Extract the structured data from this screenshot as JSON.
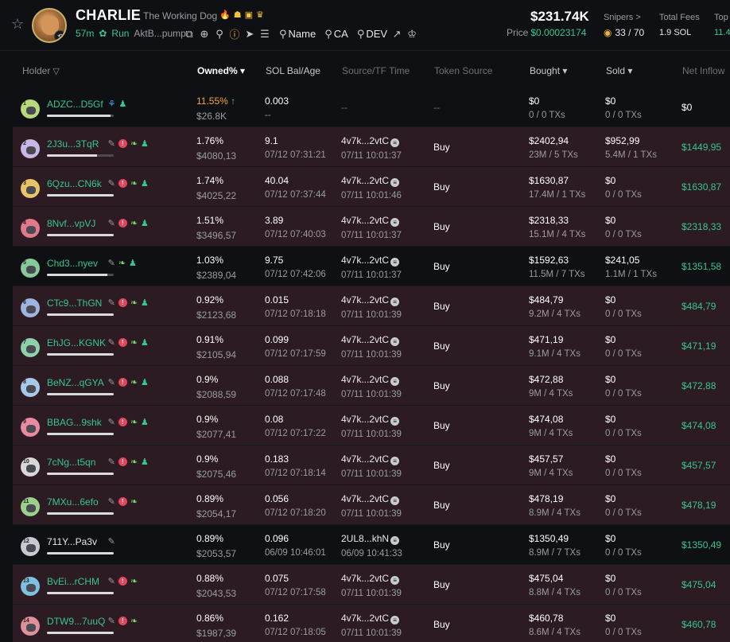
{
  "token": {
    "name": "CHARLIE",
    "subtitle": "The Working Dog",
    "age": "57m",
    "run_label": "Run",
    "address": "AktB...pump",
    "price_big": "$231.74K",
    "price_label": "Price",
    "price_value": "$0.00023174",
    "snipers_label": "Snipers >",
    "snipers_value": "33 / 70",
    "fees_label": "Total Fees",
    "fees_value": "1.9 SOL",
    "top10_label": "Top",
    "top10_value": "11.4",
    "search_name": "Name",
    "search_ca": "CA",
    "search_dev": "DEV"
  },
  "columns": {
    "holder": "Holder",
    "owned": "Owned%",
    "sol": "SOL Bal/Age",
    "source": "Source/TF Time",
    "token_source": "Token Source",
    "bought": "Bought",
    "sold": "Sold",
    "net": "Net Inflow"
  },
  "colors": {
    "accent_green": "#36c68f",
    "row_red": "#2c1b22",
    "warning_orange": "#f3a53c"
  },
  "rows": [
    {
      "rank": "1",
      "addr": "ADZC...D5Gf",
      "owned": "11.55%",
      "owned_usd": "$26.8K",
      "sol": "0.003",
      "age": "--",
      "src": "--",
      "src_time": "",
      "tsrc": "--",
      "bought": "$0",
      "bought_tx": "0 / 0 TXs",
      "sold": "$0",
      "sold_tx": "0 / 0 TXs",
      "net": "$0",
      "style": "top",
      "bar": 0.95,
      "badges": [
        "fish",
        "person"
      ]
    },
    {
      "rank": "2",
      "addr": "2J3u...3TqR",
      "owned": "1.76%",
      "owned_usd": "$4080,13",
      "sol": "9.1",
      "age": "07/12 07:31:21",
      "src": "4v7k...2vtC",
      "src_time": "07/11 10:01:37",
      "tsrc": "Buy",
      "bought": "$2402,94",
      "bought_tx": "23M / 5 TXs",
      "sold": "$952,99",
      "sold_tx": "5.4M / 1 TXs",
      "net": "$1449,95",
      "style": "red",
      "bar": 0.75,
      "badges": [
        "edit",
        "red",
        "leaf",
        "person"
      ]
    },
    {
      "rank": "3",
      "addr": "6Qzu...CN6k",
      "owned": "1.74%",
      "owned_usd": "$4025,22",
      "sol": "40.04",
      "age": "07/12 07:37:44",
      "src": "4v7k...2vtC",
      "src_time": "07/11 10:01:46",
      "tsrc": "Buy",
      "bought": "$1630,87",
      "bought_tx": "17.4M / 1 TXs",
      "sold": "$0",
      "sold_tx": "0 / 0 TXs",
      "net": "$1630,87",
      "style": "red",
      "bar": 1.0,
      "badges": [
        "edit",
        "red",
        "leaf",
        "person"
      ]
    },
    {
      "rank": "4",
      "addr": "8Nvf...vpVJ",
      "owned": "1.51%",
      "owned_usd": "$3496,57",
      "sol": "3.89",
      "age": "07/12 07:40:03",
      "src": "4v7k...2vtC",
      "src_time": "07/11 10:01:37",
      "tsrc": "Buy",
      "bought": "$2318,33",
      "bought_tx": "15.1M / 4 TXs",
      "sold": "$0",
      "sold_tx": "0 / 0 TXs",
      "net": "$2318,33",
      "style": "red",
      "bar": 1.0,
      "badges": [
        "edit",
        "red",
        "leaf",
        "person"
      ]
    },
    {
      "rank": "5",
      "addr": "Chd3...nyev",
      "owned": "1.03%",
      "owned_usd": "$2389,04",
      "sol": "9.75",
      "age": "07/12 07:42:06",
      "src": "4v7k...2vtC",
      "src_time": "07/11 10:01:37",
      "tsrc": "Buy",
      "bought": "$1592,63",
      "bought_tx": "11.5M / 7 TXs",
      "sold": "$241,05",
      "sold_tx": "1.1M / 1 TXs",
      "net": "$1351,58",
      "style": "dark",
      "bar": 0.9,
      "badges": [
        "edit",
        "leaf",
        "person"
      ]
    },
    {
      "rank": "6",
      "addr": "CTc9...ThGN",
      "owned": "0.92%",
      "owned_usd": "$2123,68",
      "sol": "0.015",
      "age": "07/12 07:18:18",
      "src": "4v7k...2vtC",
      "src_time": "07/11 10:01:39",
      "tsrc": "Buy",
      "bought": "$484,79",
      "bought_tx": "9.2M / 4 TXs",
      "sold": "$0",
      "sold_tx": "0 / 0 TXs",
      "net": "$484,79",
      "style": "red",
      "bar": 1.0,
      "badges": [
        "edit",
        "red",
        "leaf",
        "person"
      ]
    },
    {
      "rank": "7",
      "addr": "EhJG...KGNK",
      "owned": "0.91%",
      "owned_usd": "$2105,94",
      "sol": "0.099",
      "age": "07/12 07:17:59",
      "src": "4v7k...2vtC",
      "src_time": "07/11 10:01:39",
      "tsrc": "Buy",
      "bought": "$471,19",
      "bought_tx": "9.1M / 4 TXs",
      "sold": "$0",
      "sold_tx": "0 / 0 TXs",
      "net": "$471,19",
      "style": "red",
      "bar": 1.0,
      "badges": [
        "edit",
        "red",
        "leaf",
        "person"
      ]
    },
    {
      "rank": "8",
      "addr": "BeNZ...qGYA",
      "owned": "0.9%",
      "owned_usd": "$2088,59",
      "sol": "0.088",
      "age": "07/12 07:17:48",
      "src": "4v7k...2vtC",
      "src_time": "07/11 10:01:39",
      "tsrc": "Buy",
      "bought": "$472,88",
      "bought_tx": "9M / 4 TXs",
      "sold": "$0",
      "sold_tx": "0 / 0 TXs",
      "net": "$472,88",
      "style": "red",
      "bar": 1.0,
      "badges": [
        "edit",
        "red",
        "leaf",
        "person"
      ]
    },
    {
      "rank": "9",
      "addr": "BBAG...9shk",
      "owned": "0.9%",
      "owned_usd": "$2077,41",
      "sol": "0.08",
      "age": "07/12 07:17:22",
      "src": "4v7k...2vtC",
      "src_time": "07/11 10:01:39",
      "tsrc": "Buy",
      "bought": "$474,08",
      "bought_tx": "9M / 4 TXs",
      "sold": "$0",
      "sold_tx": "0 / 0 TXs",
      "net": "$474,08",
      "style": "red",
      "bar": 1.0,
      "badges": [
        "edit",
        "red",
        "leaf",
        "person"
      ]
    },
    {
      "rank": "10",
      "addr": "7cNg...t5qn",
      "owned": "0.9%",
      "owned_usd": "$2075,46",
      "sol": "0.183",
      "age": "07/12 07:18:14",
      "src": "4v7k...2vtC",
      "src_time": "07/11 10:01:39",
      "tsrc": "Buy",
      "bought": "$457,57",
      "bought_tx": "9M / 4 TXs",
      "sold": "$0",
      "sold_tx": "0 / 0 TXs",
      "net": "$457,57",
      "style": "red",
      "bar": 1.0,
      "badges": [
        "edit",
        "red",
        "leaf",
        "person"
      ]
    },
    {
      "rank": "11",
      "addr": "7MXu...6efo",
      "owned": "0.89%",
      "owned_usd": "$2054,17",
      "sol": "0.056",
      "age": "07/12 07:18:20",
      "src": "4v7k...2vtC",
      "src_time": "07/11 10:01:39",
      "tsrc": "Buy",
      "bought": "$478,19",
      "bought_tx": "8.9M / 4 TXs",
      "sold": "$0",
      "sold_tx": "0 / 0 TXs",
      "net": "$478,19",
      "style": "red",
      "bar": 1.0,
      "badges": [
        "edit",
        "red",
        "leaf"
      ]
    },
    {
      "rank": "12",
      "addr": "711Y...Pa3v",
      "owned": "0.89%",
      "owned_usd": "$2053,57",
      "sol": "0.096",
      "age": "06/09 10:46:01",
      "src": "2UL8...khN",
      "src_time": "06/09 10:41:33",
      "tsrc": "Buy",
      "bought": "$1350,49",
      "bought_tx": "8.9M / 7 TXs",
      "sold": "$0",
      "sold_tx": "0 / 0 TXs",
      "net": "$1350,49",
      "style": "dark",
      "bar": 1.0,
      "badges": [
        "edit"
      ],
      "plain": true
    },
    {
      "rank": "13",
      "addr": "BvEi...rCHM",
      "owned": "0.88%",
      "owned_usd": "$2043,53",
      "sol": "0.075",
      "age": "07/12 07:17:58",
      "src": "4v7k...2vtC",
      "src_time": "07/11 10:01:39",
      "tsrc": "Buy",
      "bought": "$475,04",
      "bought_tx": "8.8M / 4 TXs",
      "sold": "$0",
      "sold_tx": "0 / 0 TXs",
      "net": "$475,04",
      "style": "red",
      "bar": 1.0,
      "badges": [
        "edit",
        "red",
        "leaf"
      ]
    },
    {
      "rank": "14",
      "addr": "DTW9...7uuQ",
      "owned": "0.86%",
      "owned_usd": "$1987,39",
      "sol": "0.162",
      "age": "07/12 07:18:05",
      "src": "4v7k...2vtC",
      "src_time": "07/11 10:01:39",
      "tsrc": "Buy",
      "bought": "$460,78",
      "bought_tx": "8.6M / 4 TXs",
      "sold": "$0",
      "sold_tx": "0 / 0 TXs",
      "net": "$460,78",
      "style": "red",
      "bar": 1.0,
      "badges": [
        "edit",
        "red",
        "leaf"
      ]
    }
  ]
}
